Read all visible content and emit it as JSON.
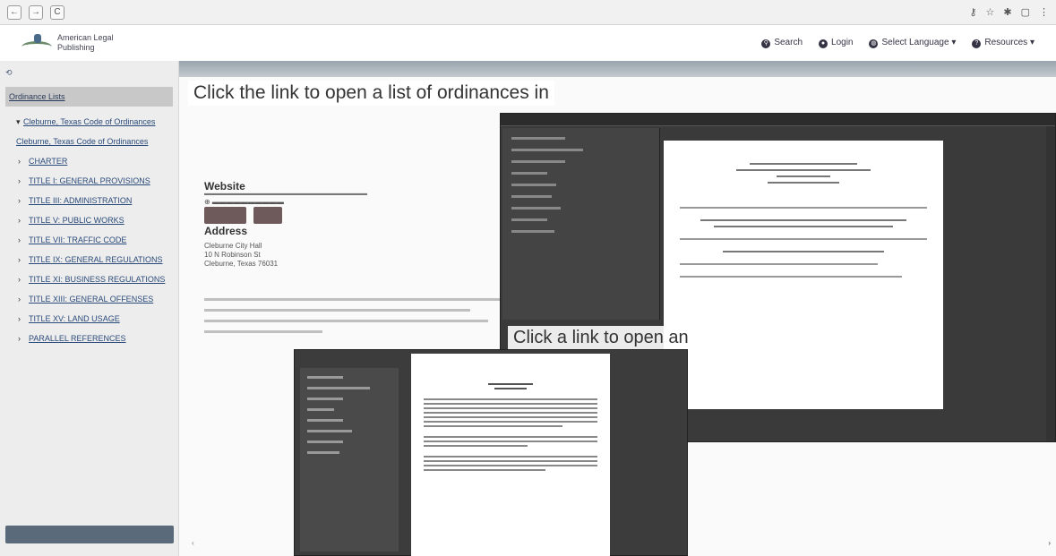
{
  "browser": {
    "back": "←",
    "forward": "→",
    "reload": "C"
  },
  "site": {
    "logo_line1": "American Legal",
    "logo_line2": "Publishing",
    "nav": [
      {
        "label": "Search",
        "icon": "search-icon"
      },
      {
        "label": "Login",
        "icon": "user-icon"
      },
      {
        "label": "Select Language",
        "icon": "globe-icon"
      },
      {
        "label": "Resources",
        "icon": "help-icon"
      }
    ]
  },
  "sidebar": {
    "selected": "Ordinance Lists",
    "items": [
      "Cleburne, Texas Code of Ordinances",
      "Cleburne, Texas Code of Ordinances",
      "CHARTER",
      "TITLE I: GENERAL PROVISIONS",
      "TITLE III: ADMINISTRATION",
      "TITLE V: PUBLIC WORKS",
      "TITLE VII: TRAFFIC CODE",
      "TITLE IX: GENERAL REGULATIONS",
      "TITLE XI: BUSINESS REGULATIONS",
      "TITLE XIII: GENERAL OFFENSES",
      "TITLE XV: LAND USAGE",
      "PARALLEL REFERENCES"
    ]
  },
  "main": {
    "website_heading": "Website",
    "address_heading": "Address",
    "address_lines": [
      "Cleburne City Hall",
      "10 N Robinson St",
      "Cleburne, Texas 76031"
    ],
    "prev_label": "‹",
    "next_label": "›"
  },
  "captions": {
    "list": "Click the link to open a list of ordinances in",
    "pdf": "Click a link to open an ordinance in .PDF"
  }
}
